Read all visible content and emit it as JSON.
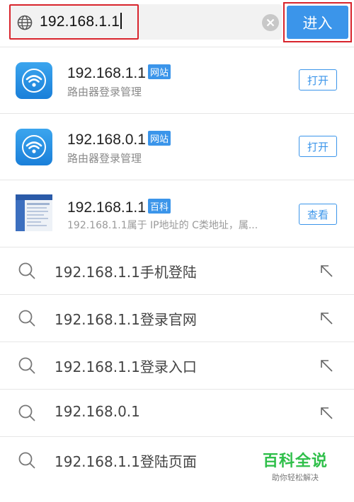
{
  "search": {
    "url_value": "192.168.1.1",
    "go_label": "进入"
  },
  "results": [
    {
      "title": "192.168.1.1",
      "tag": "网站",
      "subtitle": "路由器登录管理",
      "button": "打开",
      "icon": "wifi-app-icon"
    },
    {
      "title": "192.168.0.1",
      "tag": "网站",
      "subtitle": "路由器登录管理",
      "button": "打开",
      "icon": "wifi-app-icon"
    },
    {
      "title": "192.168.1.1",
      "tag": "百科",
      "subtitle": "192.168.1.1属于 IP地址的 C类地址，属...",
      "button": "查看",
      "icon": "router-page-thumbnail"
    }
  ],
  "suggestions": [
    "192.168.1.1手机登陆",
    "192.168.1.1登录官网",
    "192.168.1.1登录入口",
    "192.168.0.1",
    "192.168.1.1登陆页面"
  ],
  "watermark": {
    "title": "百科全说",
    "subtitle": "助你轻松解决"
  },
  "colors": {
    "accent": "#3b95ea",
    "highlight_border": "#d8242c",
    "watermark_green": "#2fbf4a"
  }
}
